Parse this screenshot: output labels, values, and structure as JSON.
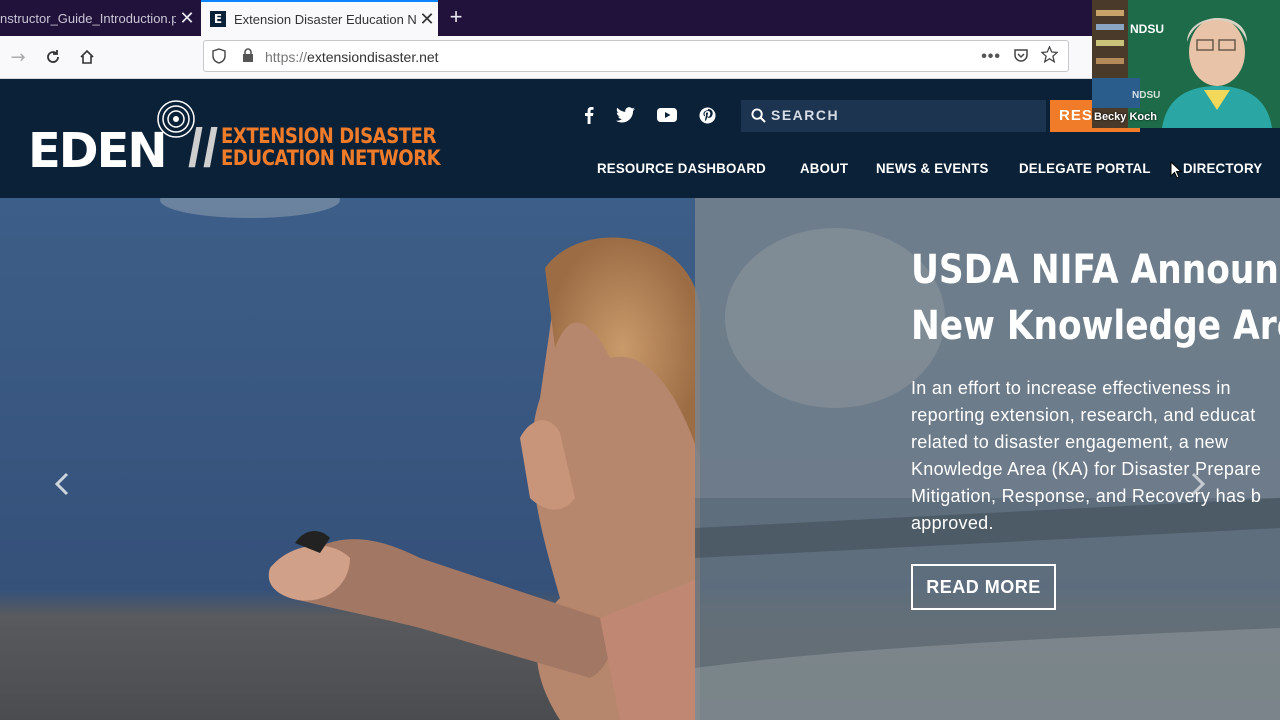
{
  "browser": {
    "tabs": [
      {
        "title": "nstructor_Guide_Introduction.p",
        "active": false
      },
      {
        "title": "Extension Disaster Education N",
        "active": true
      }
    ],
    "url_scheme": "https://",
    "url_host": "extensiondisaster.net",
    "favicon_letter": "E"
  },
  "site": {
    "logo": {
      "wordmark": "EDEN",
      "line1": "EXTENSION DISASTER",
      "line2": "EDUCATION NETWORK"
    },
    "social_icons": [
      "facebook-icon",
      "twitter-icon",
      "youtube-icon",
      "pinterest-icon"
    ],
    "search_placeholder": "SEARCH",
    "resource_button": "RESOURCES",
    "nav": [
      {
        "label": "RESOURCE DASHBOARD"
      },
      {
        "label": "ABOUT"
      },
      {
        "label": "NEWS & EVENTS"
      },
      {
        "label": "DELEGATE PORTAL"
      },
      {
        "label": "DIRECTORY"
      }
    ],
    "brand_colors": {
      "navy": "#0b2138",
      "orange": "#f07c2a"
    }
  },
  "hero": {
    "headline_line1": "USDA NIFA Announces",
    "headline_line2": "New Knowledge Area",
    "summary": "In an effort to increase effectiveness in\nreporting extension, research, and educat\nrelated to disaster engagement, a new\nKnowledge Area (KA) for Disaster Prepare\nMitigation, Response, and Recovery has b\napproved.",
    "read_more": "READ MORE"
  },
  "webcam": {
    "participant_name": "Becky Koch",
    "backdrop_text": "NDSU"
  }
}
